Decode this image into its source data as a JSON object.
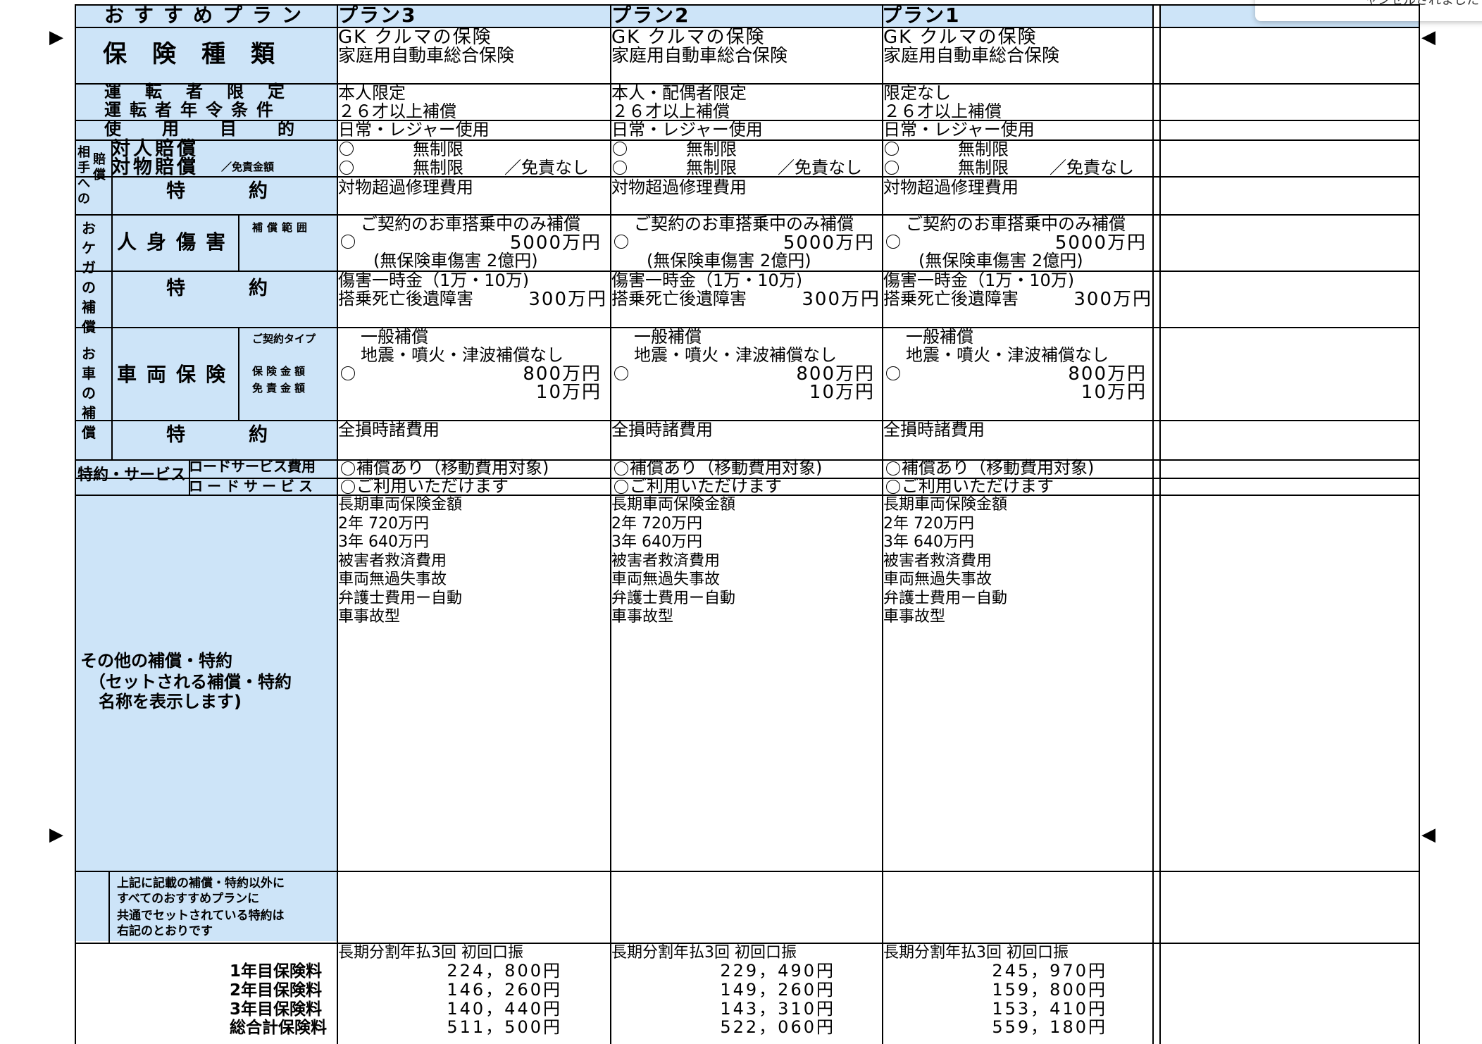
{
  "header": {
    "label": "おすすめプラン",
    "plans": [
      "プラン3",
      "プラン2",
      "プラン1"
    ]
  },
  "toast": "ャンセルされました",
  "arrow_left": "▶",
  "arrow_right": "◀",
  "labels": {
    "insurance_type": "保険種類",
    "driver_limit": "運転者限定",
    "driver_age": "運転者年令条件",
    "use_purpose": "使用目的",
    "opponent_side": "相手への",
    "opponent_side2": "賠償",
    "bodily_liability": "対人賠償",
    "property_liability": "対物賠償",
    "deductible_note": "／免責金額",
    "special": "特約",
    "injury_side": "おケガの補償",
    "personal_injury": "人身傷害",
    "coverage_scope": "補償範囲",
    "car_side": "お車の補償",
    "vehicle_insurance": "車両保険",
    "contract_type": "ご契約タイプ",
    "insured_amount": "保険金額",
    "deductible_amount": "免責金額",
    "services": "特約・サービス",
    "road_service_fee": "ロードサービス費用",
    "road_service": "ロードサービス",
    "other_coverage": [
      "その他の補償・特約",
      "（セットされる補償・特約",
      "名称を表示します)"
    ],
    "common_note": [
      "上記に記載の補償・特約以外に",
      "すべてのおすすめプランに",
      "共通でセットされている特約は",
      "右記のとおりです"
    ],
    "premium_1": "1年目保険料",
    "premium_2": "2年目保険料",
    "premium_3": "3年目保険料",
    "premium_total": "総合計保険料"
  },
  "plans": [
    {
      "type_1": "GK クルマの保険",
      "type_2": "家庭用自動車総合保険",
      "driver_limit": "本人限定",
      "driver_age": "２６才以上補償",
      "use_purpose": "日常・レジャー使用",
      "bodily": "無制限",
      "property": "無制限",
      "property_ded": "／免責なし",
      "opp_special": "対物超過修理費用",
      "injury_scope": "ご契約のお車搭乗中のみ補償",
      "injury_amount": "5000万円",
      "injury_note": "(無保険車傷害 2億円)",
      "injury_special_1": "傷害一時金（1万・10万)",
      "injury_special_2": "搭乗死亡後遺障害",
      "injury_special_2_amt": "300万円",
      "vehicle_type": "一般補償",
      "vehicle_quake": "地震・噴火・津波補償なし",
      "vehicle_amount": "800万円",
      "vehicle_ded": "10万円",
      "vehicle_special": "全損時諸費用",
      "road_fee": "補償あり（移動費用対象)",
      "road_service": "ご利用いただけます",
      "other": [
        "長期車両保険金額",
        "2年 720万円",
        "3年 640万円",
        "被害者救済費用",
        "車両無過失事故",
        "弁護士費用ー自動",
        "車事故型"
      ],
      "payment": "長期分割年払3回 初回口振",
      "p1": "224，800円",
      "p2": "146，260円",
      "p3": "140，440円",
      "total": "511，500円"
    },
    {
      "type_1": "GK クルマの保険",
      "type_2": "家庭用自動車総合保険",
      "driver_limit": "本人・配偶者限定",
      "driver_age": "２６才以上補償",
      "use_purpose": "日常・レジャー使用",
      "bodily": "無制限",
      "property": "無制限",
      "property_ded": "／免責なし",
      "opp_special": "対物超過修理費用",
      "injury_scope": "ご契約のお車搭乗中のみ補償",
      "injury_amount": "5000万円",
      "injury_note": "(無保険車傷害 2億円)",
      "injury_special_1": "傷害一時金（1万・10万)",
      "injury_special_2": "搭乗死亡後遺障害",
      "injury_special_2_amt": "300万円",
      "vehicle_type": "一般補償",
      "vehicle_quake": "地震・噴火・津波補償なし",
      "vehicle_amount": "800万円",
      "vehicle_ded": "10万円",
      "vehicle_special": "全損時諸費用",
      "road_fee": "補償あり（移動費用対象)",
      "road_service": "ご利用いただけます",
      "other": [
        "長期車両保険金額",
        "2年 720万円",
        "3年 640万円",
        "被害者救済費用",
        "車両無過失事故",
        "弁護士費用ー自動",
        "車事故型"
      ],
      "payment": "長期分割年払3回 初回口振",
      "p1": "229，490円",
      "p2": "149，260円",
      "p3": "143，310円",
      "total": "522，060円"
    },
    {
      "type_1": "GK クルマの保険",
      "type_2": "家庭用自動車総合保険",
      "driver_limit": "限定なし",
      "driver_age": "２６才以上補償",
      "use_purpose": "日常・レジャー使用",
      "bodily": "無制限",
      "property": "無制限",
      "property_ded": "／免責なし",
      "opp_special": "対物超過修理費用",
      "injury_scope": "ご契約のお車搭乗中のみ補償",
      "injury_amount": "5000万円",
      "injury_note": "(無保険車傷害 2億円)",
      "injury_special_1": "傷害一時金（1万・10万)",
      "injury_special_2": "搭乗死亡後遺障害",
      "injury_special_2_amt": "300万円",
      "vehicle_type": "一般補償",
      "vehicle_quake": "地震・噴火・津波補償なし",
      "vehicle_amount": "800万円",
      "vehicle_ded": "10万円",
      "vehicle_special": "全損時諸費用",
      "road_fee": "補償あり（移動費用対象)",
      "road_service": "ご利用いただけます",
      "other": [
        "長期車両保険金額",
        "2年 720万円",
        "3年 640万円",
        "被害者救済費用",
        "車両無過失事故",
        "弁護士費用ー自動",
        "車事故型"
      ],
      "payment": "長期分割年払3回 初回口振",
      "p1": "245，970円",
      "p2": "159，800円",
      "p3": "153，410円",
      "total": "559，180円"
    }
  ]
}
